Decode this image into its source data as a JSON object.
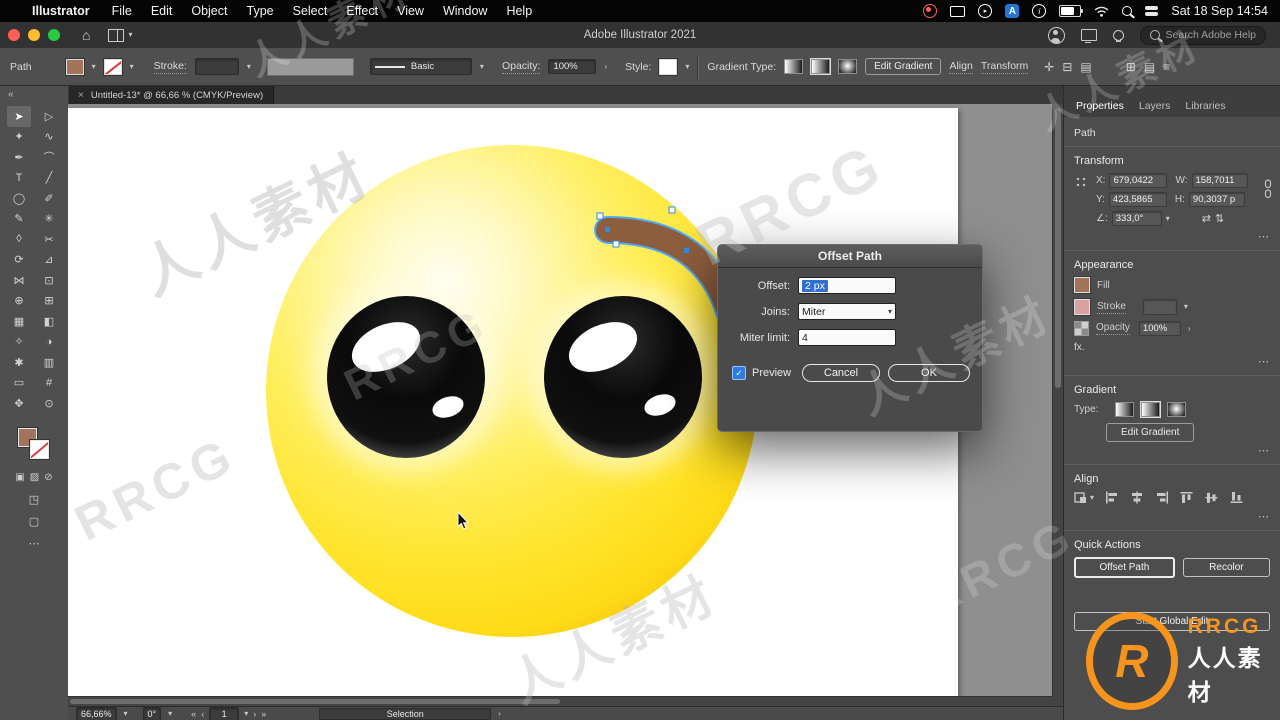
{
  "menubar": {
    "apple": "",
    "app_name": "Illustrator",
    "menus": [
      "File",
      "Edit",
      "Object",
      "Type",
      "Select",
      "Effect",
      "View",
      "Window",
      "Help"
    ],
    "input_badge": "A",
    "clock": "Sat 18 Sep 14:54"
  },
  "titlebar": {
    "title": "Adobe Illustrator 2021",
    "help_search_placeholder": "Search Adobe Help"
  },
  "controlbar": {
    "context_label": "Path",
    "stroke_label": "Stroke:",
    "brush_value": "Basic",
    "opacity_label": "Opacity:",
    "opacity_value": "100%",
    "style_label": "Style:",
    "gradient_type_label": "Gradient Type:",
    "edit_gradient": "Edit Gradient",
    "align_label": "Align",
    "transform_label": "Transform"
  },
  "document_tab": {
    "close": "×",
    "title": "Untitled-13* @ 66,66 % (CMYK/Preview)"
  },
  "toolbar": {
    "collapse": "«",
    "more": "⋯",
    "tools": [
      {
        "name": "selection-tool",
        "glyph": "➤"
      },
      {
        "name": "direct-selection-tool",
        "glyph": "▷"
      },
      {
        "name": "magic-wand-tool",
        "glyph": "✦"
      },
      {
        "name": "lasso-tool",
        "glyph": "∿"
      },
      {
        "name": "pen-tool",
        "glyph": "✒"
      },
      {
        "name": "curvature-tool",
        "glyph": "⌒"
      },
      {
        "name": "type-tool",
        "glyph": "T"
      },
      {
        "name": "line-segment-tool",
        "glyph": "╱"
      },
      {
        "name": "ellipse-tool",
        "glyph": "◯"
      },
      {
        "name": "paintbrush-tool",
        "glyph": "✐"
      },
      {
        "name": "pencil-tool",
        "glyph": "✎"
      },
      {
        "name": "shaper-tool",
        "glyph": "✳"
      },
      {
        "name": "eraser-tool",
        "glyph": "◊"
      },
      {
        "name": "scissors-tool",
        "glyph": "✂"
      },
      {
        "name": "rotate-tool",
        "glyph": "⟳"
      },
      {
        "name": "scale-tool",
        "glyph": "⊿"
      },
      {
        "name": "width-tool",
        "glyph": "⋈"
      },
      {
        "name": "free-transform-tool",
        "glyph": "⊡"
      },
      {
        "name": "shape-builder-tool",
        "glyph": "⊕"
      },
      {
        "name": "perspective-grid-tool",
        "glyph": "⊞"
      },
      {
        "name": "mesh-tool",
        "glyph": "▦"
      },
      {
        "name": "gradient-tool",
        "glyph": "◧"
      },
      {
        "name": "eyedropper-tool",
        "glyph": "✧"
      },
      {
        "name": "blend-tool",
        "glyph": "◑"
      },
      {
        "name": "symbol-sprayer-tool",
        "glyph": "✱"
      },
      {
        "name": "column-graph-tool",
        "glyph": "▥"
      },
      {
        "name": "artboard-tool",
        "glyph": "▭"
      },
      {
        "name": "slice-tool",
        "glyph": "#"
      },
      {
        "name": "hand-tool",
        "glyph": "✥"
      },
      {
        "name": "zoom-tool",
        "glyph": "⊙"
      }
    ]
  },
  "dialog": {
    "title": "Offset Path",
    "offset_label": "Offset:",
    "offset_value": "2 px",
    "joins_label": "Joins:",
    "joins_value": "Miter",
    "miter_limit_label": "Miter limit:",
    "miter_limit_value": "4",
    "preview_label": "Preview",
    "cancel": "Cancel",
    "ok": "OK"
  },
  "panel": {
    "tabs": [
      "Properties",
      "Layers",
      "Libraries"
    ],
    "context_label": "Path",
    "transform": {
      "title": "Transform",
      "x_label": "X:",
      "x_value": "679,0422",
      "y_label": "Y:",
      "y_value": "423,5865",
      "w_label": "W:",
      "w_value": "158,7011",
      "h_label": "H:",
      "h_value": "90,3037 p",
      "angle_value": "333,0°"
    },
    "appearance": {
      "title": "Appearance",
      "fill_label": "Fill",
      "stroke_label": "Stroke",
      "opacity_label": "Opacity",
      "opacity_value": "100%",
      "fx_label": "fx."
    },
    "gradient": {
      "title": "Gradient",
      "type_label": "Type:",
      "edit_gradient": "Edit Gradient"
    },
    "align": {
      "title": "Align"
    },
    "quick_actions": {
      "title": "Quick Actions",
      "offset_path": "Offset Path",
      "recolor": "Recolor",
      "start_global_edit": "Start Global Edit"
    }
  },
  "statusbar": {
    "zoom": "66,66%",
    "rotation": "0°",
    "artboard": "1",
    "tool": "Selection"
  },
  "watermark": {
    "cn": "人人素材",
    "en": "RRCG",
    "logo_monogram": "R",
    "logo_brand": "RRCG",
    "logo_sub": "人人素材"
  },
  "icons": {
    "chevron_down": "▾",
    "chevron_right": "›",
    "ellipsis": "⋯",
    "home": "⌂",
    "info": "i",
    "play": "▸",
    "check": "✓",
    "nav_first": "«",
    "nav_prev": "‹",
    "nav_next": "›",
    "nav_last": "»",
    "angle": "∠:",
    "flip_h": "⇄",
    "flip_v": "⇅",
    "swatch_color": "▣",
    "swatch_gradient": "▨",
    "swatch_none": "⊘",
    "draw_mode": "◳",
    "screen_mode": "▢",
    "transform_widget": "✛",
    "arrange": "⊟",
    "snap_grid": "⊞",
    "layout": "▤",
    "menu": "≡"
  },
  "colors": {
    "accent_blue": "#2d7de1",
    "emoji_yellow": "#ffe838",
    "eyebrow_brown": "#8d5e3e",
    "watermark_orange": "#f7941d"
  }
}
